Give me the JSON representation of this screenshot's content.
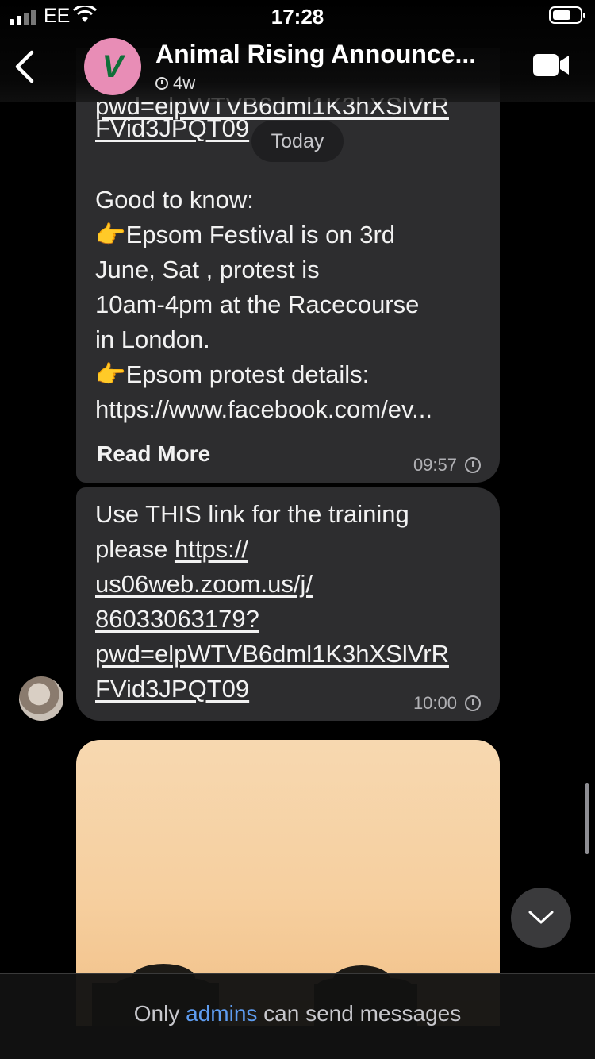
{
  "status_bar": {
    "carrier": "EE",
    "time": "17:28"
  },
  "header": {
    "channel_title": "Animal Rising Announce...",
    "avatar_text": "V",
    "timer_label": "4w"
  },
  "date_separator": "Today",
  "messages": [
    {
      "lines": [
        "pwd=elpWTVB6dml1K3hXSlVrR",
        "FVid3JPQT09",
        "",
        "Good to know:",
        "👉Epsom Festival is on 3rd",
        "June, Sat , protest is",
        "10am-4pm at the Racecourse",
        "in London.",
        "👉Epsom protest details:",
        "https://www.facebook.com/ev..."
      ],
      "read_more": "Read More",
      "time": "09:57"
    },
    {
      "lines": [
        "Use THIS link for the training",
        "please https://",
        "us06web.zoom.us/j/",
        "86033063179?",
        "pwd=elpWTVB6dml1K3hXSlVrR",
        "FVid3JPQT09"
      ],
      "time": "10:00"
    }
  ],
  "footer": {
    "prefix": "Only ",
    "admins": "admins",
    "suffix": " can send messages"
  },
  "icons": [
    "back-chevron-icon",
    "video-call-icon",
    "timer-icon",
    "clock-icon",
    "chevron-down-icon"
  ]
}
